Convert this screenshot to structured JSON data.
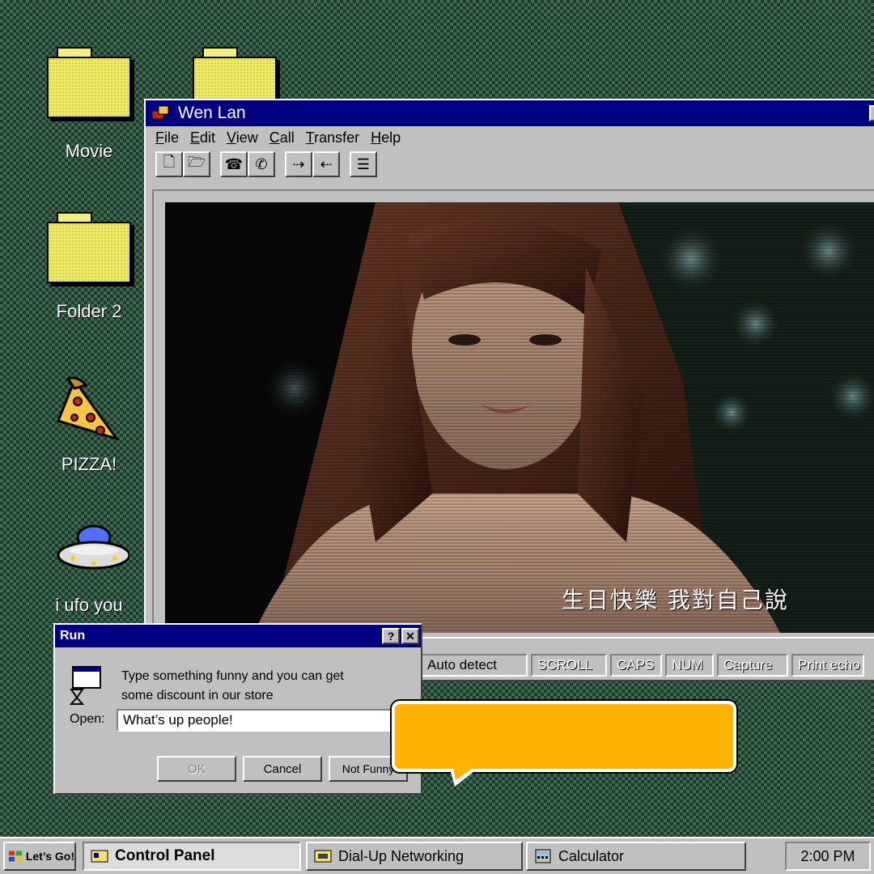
{
  "desktop": {
    "icons": [
      {
        "label": "Movie",
        "icon": "folder-icon"
      },
      {
        "label": "",
        "icon": "folder-icon"
      },
      {
        "label": "Folder 2",
        "icon": "folder-icon"
      },
      {
        "label": "PIZZA!",
        "icon": "pizza-icon"
      },
      {
        "label": "i ufo you",
        "icon": "ufo-icon"
      }
    ]
  },
  "window": {
    "title": "Wen Lan",
    "menu": [
      "File",
      "Edit",
      "View",
      "Call",
      "Transfer",
      "Help"
    ],
    "toolbar_icons": [
      "new-icon",
      "open-icon",
      "phone-icon",
      "dial-icon",
      "send-icon",
      "receive-icon",
      "properties-icon"
    ],
    "video_caption": "生日快樂 我對自己說",
    "status": {
      "auto_detect": "Auto detect",
      "scroll": "SCROLL",
      "caps": "CAPS",
      "num": "NUM",
      "capture": "Capture",
      "print_echo": "Print echo"
    }
  },
  "run_dialog": {
    "title": "Run",
    "help_glyph": "?",
    "close_glyph": "✕",
    "message_line1": "Type something funny and you can get",
    "message_line2": "some discount in our store",
    "open_label": "Open:",
    "open_value": "What’s  up people!",
    "ok_label": "OK",
    "cancel_label": "Cancel",
    "not_funny_label": "Not Funny"
  },
  "speech_bubble": {
    "color": "#ffb400",
    "text": ""
  },
  "taskbar": {
    "start_label": "Let’s Go!",
    "tasks": [
      "Control Panel",
      "Dial-Up Networking",
      "Calculator"
    ],
    "active_task": "Control Panel",
    "clock": "2:00 PM"
  },
  "colors": {
    "title_bar": "#000080",
    "face": "#c0c0c0",
    "bubble": "#ffb400"
  }
}
